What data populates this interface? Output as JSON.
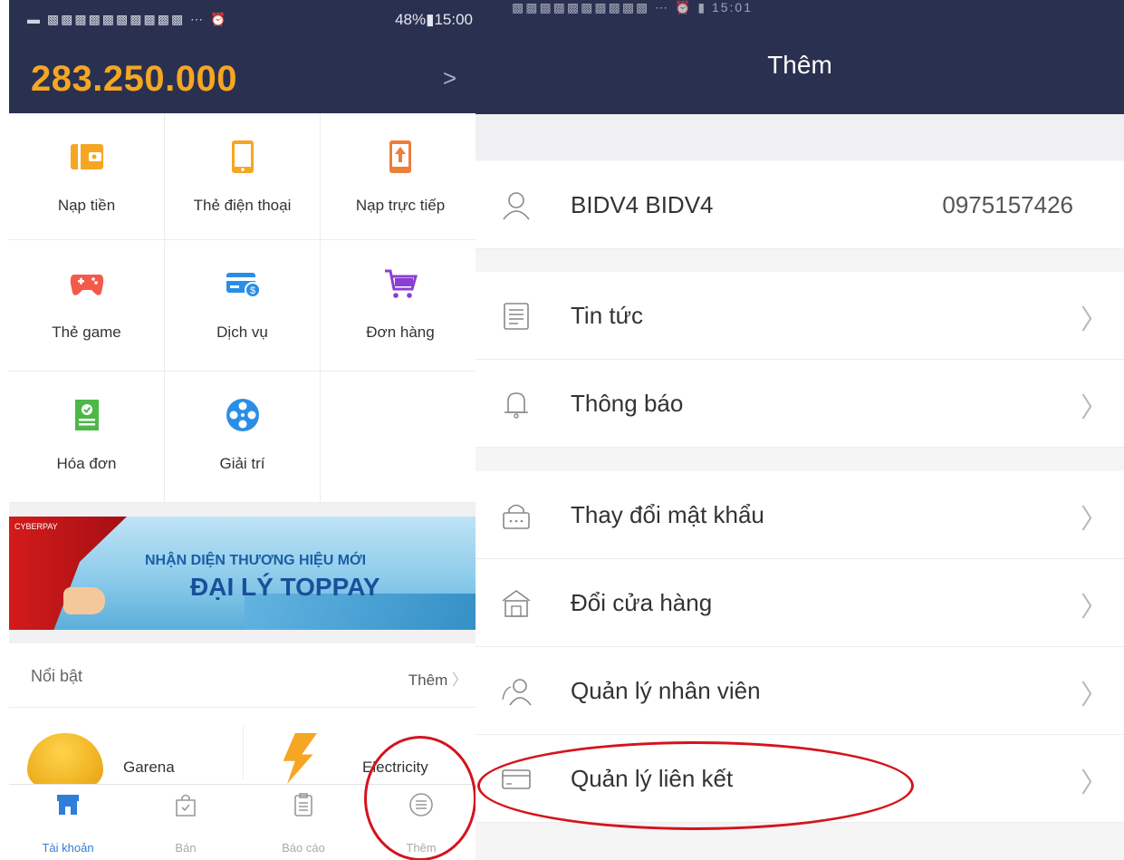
{
  "left": {
    "status_right": "48%▮15:00",
    "balance": "283.250.000",
    "balance_arrow": ">",
    "grid": [
      {
        "label": "Nạp tiền",
        "icon": "wallet-icon"
      },
      {
        "label": "Thẻ điện thoại",
        "icon": "phone-card-icon"
      },
      {
        "label": "Nạp trực tiếp",
        "icon": "phone-topup-icon"
      },
      {
        "label": "Thẻ game",
        "icon": "gamepad-icon"
      },
      {
        "label": "Dịch vụ",
        "icon": "service-card-icon"
      },
      {
        "label": "Đơn hàng",
        "icon": "cart-icon"
      },
      {
        "label": "Hóa đơn",
        "icon": "bill-icon"
      },
      {
        "label": "Giải trí",
        "icon": "film-reel-icon"
      }
    ],
    "banner": {
      "logo": "CYBERPAY",
      "line1": "NHẬN DIỆN THƯƠNG HIỆU MỚI",
      "line2": "ĐẠI LÝ TOPPAY"
    },
    "featured": {
      "title": "Nổi bật",
      "more": "Thêm"
    },
    "featured_items": [
      "Garena",
      "Electricity"
    ],
    "tabs": [
      {
        "label": "Tài khoản",
        "icon": "store-icon",
        "active": true
      },
      {
        "label": "Bán",
        "icon": "shopping-bag-icon",
        "active": false
      },
      {
        "label": "Báo cáo",
        "icon": "clipboard-icon",
        "active": false
      },
      {
        "label": "Thêm",
        "icon": "menu-circle-icon",
        "active": false
      }
    ],
    "colors": {
      "header": "#2a3150",
      "balance": "#f5a623",
      "active_tab": "#2f7ed8",
      "highlight": "#d4141d"
    }
  },
  "right": {
    "title": "Thêm",
    "profile": {
      "name": "BIDV4 BIDV4",
      "phone": "0975157426"
    },
    "menu_group1": [
      {
        "label": "Tin tức",
        "icon": "news-icon"
      },
      {
        "label": "Thông báo",
        "icon": "bell-icon"
      }
    ],
    "menu_group2": [
      {
        "label": "Thay đổi mật khẩu",
        "icon": "password-icon"
      },
      {
        "label": "Đổi cửa hàng",
        "icon": "storefront-icon"
      },
      {
        "label": "Quản lý nhân viên",
        "icon": "staff-icon"
      },
      {
        "label": "Quản lý liên kết",
        "icon": "linked-card-icon"
      }
    ]
  }
}
